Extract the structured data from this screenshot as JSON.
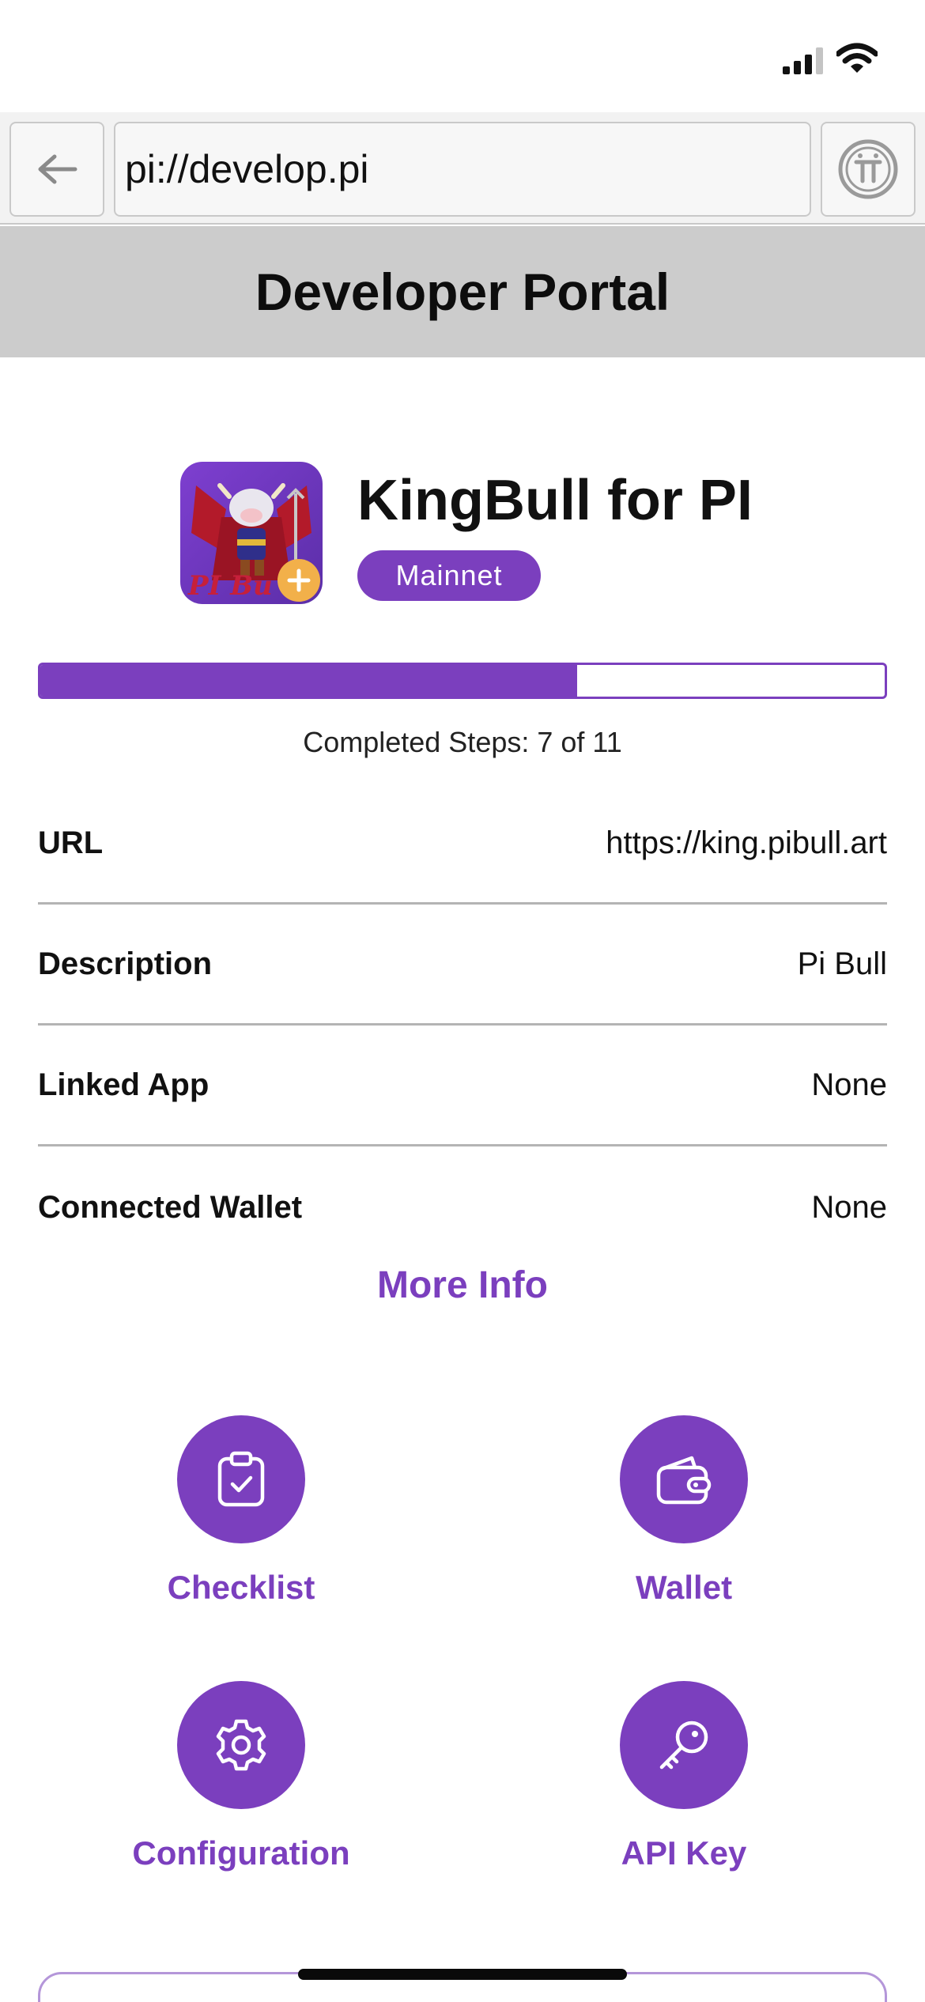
{
  "browser": {
    "url": "pi://develop.pi"
  },
  "header": {
    "title": "Developer Portal"
  },
  "app": {
    "name": "KingBull for PI",
    "network_badge": "Mainnet",
    "icon_text": "PI Bu"
  },
  "progress": {
    "completed": 7,
    "total": 11,
    "fraction": 0.636,
    "label": "Completed Steps: 7 of 11"
  },
  "info": {
    "rows": [
      {
        "label": "URL",
        "value": "https://king.pibull.art"
      },
      {
        "label": "Description",
        "value": "Pi Bull"
      },
      {
        "label": "Linked App",
        "value": "None"
      },
      {
        "label": "Connected Wallet",
        "value": "None"
      }
    ],
    "more_info": "More Info"
  },
  "actions": [
    {
      "label": "Checklist",
      "icon": "clipboard-check-icon"
    },
    {
      "label": "Wallet",
      "icon": "wallet-icon"
    },
    {
      "label": "Configuration",
      "icon": "gear-icon"
    },
    {
      "label": "API Key",
      "icon": "key-icon"
    }
  ],
  "colors": {
    "accent": "#7b3fbe",
    "title_band": "#cccccc",
    "badge_plus": "#f2b04a"
  }
}
